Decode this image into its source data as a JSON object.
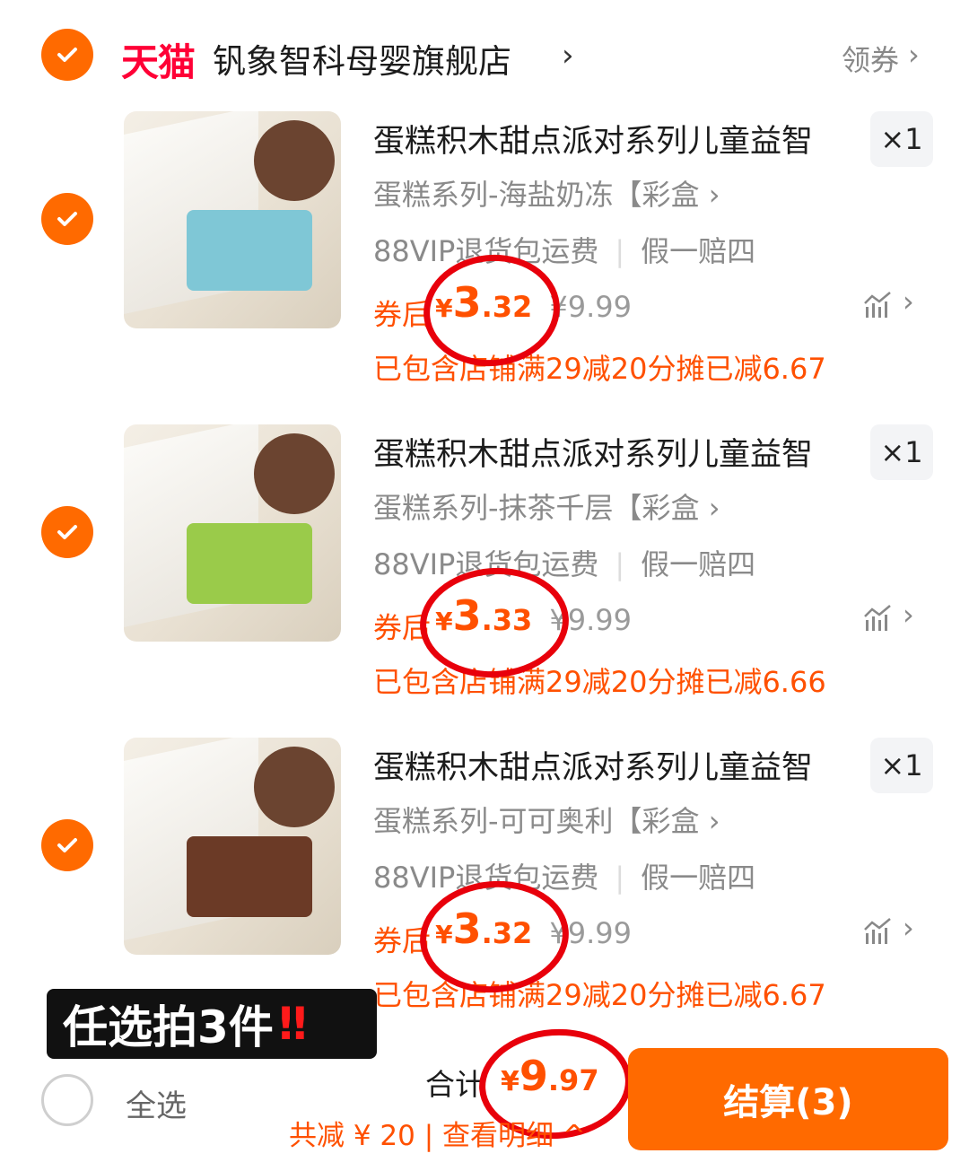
{
  "shop": {
    "platform": "天猫",
    "name": "钒象智科母婴旗舰店",
    "arrow": "›",
    "coupon": "领券",
    "coupon_arrow": "›",
    "selected": true
  },
  "items": [
    {
      "title": "蛋糕积木甜点派对系列儿童益智",
      "sku": "蛋糕系列-海盐奶冻【彩盒 ›",
      "service_1": "88VIP退货包运费",
      "service_2": "假一赔四",
      "quantity": "×1",
      "price_label": "券后",
      "currency": "¥",
      "price_int": "3",
      "price_dec": ".32",
      "original": "¥9.99",
      "promo": "已包含店铺满29减20分摊已减6.67",
      "arrow": "›",
      "selected": true,
      "thumb_color": "#7fc7d6"
    },
    {
      "title": "蛋糕积木甜点派对系列儿童益智",
      "sku": "蛋糕系列-抹茶千层【彩盒 ›",
      "service_1": "88VIP退货包运费",
      "service_2": "假一赔四",
      "quantity": "×1",
      "price_label": "券后",
      "currency": "¥",
      "price_int": "3",
      "price_dec": ".33",
      "original": "¥9.99",
      "promo": "已包含店铺满29减20分摊已减6.66",
      "arrow": "›",
      "selected": true,
      "thumb_color": "#9acb4a"
    },
    {
      "title": "蛋糕积木甜点派对系列儿童益智",
      "sku": "蛋糕系列-可可奥利【彩盒 ›",
      "service_1": "88VIP退货包运费",
      "service_2": "假一赔四",
      "quantity": "×1",
      "price_label": "券后",
      "currency": "¥",
      "price_int": "3",
      "price_dec": ".32",
      "original": "¥9.99",
      "promo": "已包含店铺满29减20分摊已减6.67",
      "arrow": "›",
      "selected": true,
      "thumb_color": "#6b3a26"
    }
  ],
  "overlay": {
    "badge_text": "任选拍3件",
    "badge_excl": "‼"
  },
  "footer": {
    "select_all": "全选",
    "total_label": "合计",
    "total_currency": "¥",
    "total_int": "9",
    "total_dec": ".97",
    "saving": "共减 ¥ 20 | 查看明细 ^",
    "checkout": "结算(3)"
  },
  "colors": {
    "accent": "#ff6a00",
    "price": "#ff5000",
    "tmall": "#ff0036",
    "annotation": "#e8000b"
  }
}
